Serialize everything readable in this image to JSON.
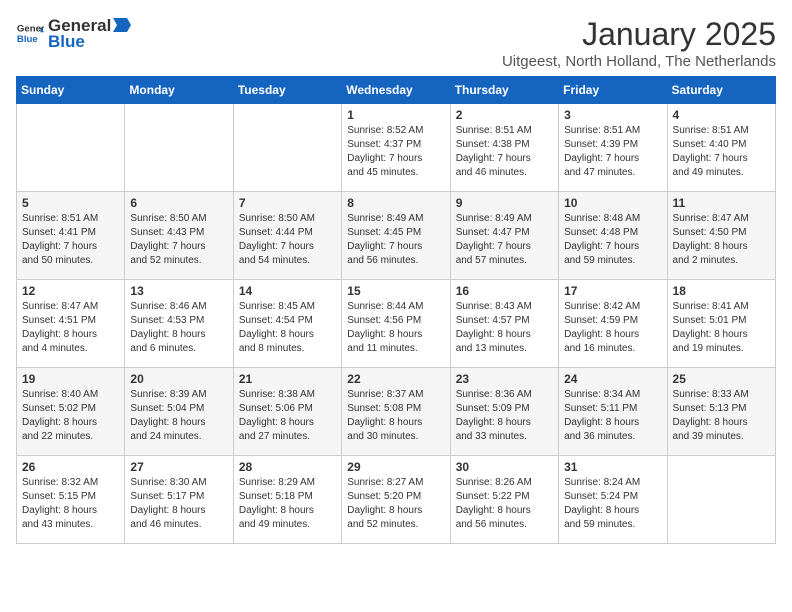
{
  "logo": {
    "line1": "General",
    "line2": "Blue"
  },
  "title": "January 2025",
  "location": "Uitgeest, North Holland, The Netherlands",
  "days_of_week": [
    "Sunday",
    "Monday",
    "Tuesday",
    "Wednesday",
    "Thursday",
    "Friday",
    "Saturday"
  ],
  "weeks": [
    [
      {
        "num": "",
        "info": ""
      },
      {
        "num": "",
        "info": ""
      },
      {
        "num": "",
        "info": ""
      },
      {
        "num": "1",
        "info": "Sunrise: 8:52 AM\nSunset: 4:37 PM\nDaylight: 7 hours\nand 45 minutes."
      },
      {
        "num": "2",
        "info": "Sunrise: 8:51 AM\nSunset: 4:38 PM\nDaylight: 7 hours\nand 46 minutes."
      },
      {
        "num": "3",
        "info": "Sunrise: 8:51 AM\nSunset: 4:39 PM\nDaylight: 7 hours\nand 47 minutes."
      },
      {
        "num": "4",
        "info": "Sunrise: 8:51 AM\nSunset: 4:40 PM\nDaylight: 7 hours\nand 49 minutes."
      }
    ],
    [
      {
        "num": "5",
        "info": "Sunrise: 8:51 AM\nSunset: 4:41 PM\nDaylight: 7 hours\nand 50 minutes."
      },
      {
        "num": "6",
        "info": "Sunrise: 8:50 AM\nSunset: 4:43 PM\nDaylight: 7 hours\nand 52 minutes."
      },
      {
        "num": "7",
        "info": "Sunrise: 8:50 AM\nSunset: 4:44 PM\nDaylight: 7 hours\nand 54 minutes."
      },
      {
        "num": "8",
        "info": "Sunrise: 8:49 AM\nSunset: 4:45 PM\nDaylight: 7 hours\nand 56 minutes."
      },
      {
        "num": "9",
        "info": "Sunrise: 8:49 AM\nSunset: 4:47 PM\nDaylight: 7 hours\nand 57 minutes."
      },
      {
        "num": "10",
        "info": "Sunrise: 8:48 AM\nSunset: 4:48 PM\nDaylight: 7 hours\nand 59 minutes."
      },
      {
        "num": "11",
        "info": "Sunrise: 8:47 AM\nSunset: 4:50 PM\nDaylight: 8 hours\nand 2 minutes."
      }
    ],
    [
      {
        "num": "12",
        "info": "Sunrise: 8:47 AM\nSunset: 4:51 PM\nDaylight: 8 hours\nand 4 minutes."
      },
      {
        "num": "13",
        "info": "Sunrise: 8:46 AM\nSunset: 4:53 PM\nDaylight: 8 hours\nand 6 minutes."
      },
      {
        "num": "14",
        "info": "Sunrise: 8:45 AM\nSunset: 4:54 PM\nDaylight: 8 hours\nand 8 minutes."
      },
      {
        "num": "15",
        "info": "Sunrise: 8:44 AM\nSunset: 4:56 PM\nDaylight: 8 hours\nand 11 minutes."
      },
      {
        "num": "16",
        "info": "Sunrise: 8:43 AM\nSunset: 4:57 PM\nDaylight: 8 hours\nand 13 minutes."
      },
      {
        "num": "17",
        "info": "Sunrise: 8:42 AM\nSunset: 4:59 PM\nDaylight: 8 hours\nand 16 minutes."
      },
      {
        "num": "18",
        "info": "Sunrise: 8:41 AM\nSunset: 5:01 PM\nDaylight: 8 hours\nand 19 minutes."
      }
    ],
    [
      {
        "num": "19",
        "info": "Sunrise: 8:40 AM\nSunset: 5:02 PM\nDaylight: 8 hours\nand 22 minutes."
      },
      {
        "num": "20",
        "info": "Sunrise: 8:39 AM\nSunset: 5:04 PM\nDaylight: 8 hours\nand 24 minutes."
      },
      {
        "num": "21",
        "info": "Sunrise: 8:38 AM\nSunset: 5:06 PM\nDaylight: 8 hours\nand 27 minutes."
      },
      {
        "num": "22",
        "info": "Sunrise: 8:37 AM\nSunset: 5:08 PM\nDaylight: 8 hours\nand 30 minutes."
      },
      {
        "num": "23",
        "info": "Sunrise: 8:36 AM\nSunset: 5:09 PM\nDaylight: 8 hours\nand 33 minutes."
      },
      {
        "num": "24",
        "info": "Sunrise: 8:34 AM\nSunset: 5:11 PM\nDaylight: 8 hours\nand 36 minutes."
      },
      {
        "num": "25",
        "info": "Sunrise: 8:33 AM\nSunset: 5:13 PM\nDaylight: 8 hours\nand 39 minutes."
      }
    ],
    [
      {
        "num": "26",
        "info": "Sunrise: 8:32 AM\nSunset: 5:15 PM\nDaylight: 8 hours\nand 43 minutes."
      },
      {
        "num": "27",
        "info": "Sunrise: 8:30 AM\nSunset: 5:17 PM\nDaylight: 8 hours\nand 46 minutes."
      },
      {
        "num": "28",
        "info": "Sunrise: 8:29 AM\nSunset: 5:18 PM\nDaylight: 8 hours\nand 49 minutes."
      },
      {
        "num": "29",
        "info": "Sunrise: 8:27 AM\nSunset: 5:20 PM\nDaylight: 8 hours\nand 52 minutes."
      },
      {
        "num": "30",
        "info": "Sunrise: 8:26 AM\nSunset: 5:22 PM\nDaylight: 8 hours\nand 56 minutes."
      },
      {
        "num": "31",
        "info": "Sunrise: 8:24 AM\nSunset: 5:24 PM\nDaylight: 8 hours\nand 59 minutes."
      },
      {
        "num": "",
        "info": ""
      }
    ]
  ]
}
